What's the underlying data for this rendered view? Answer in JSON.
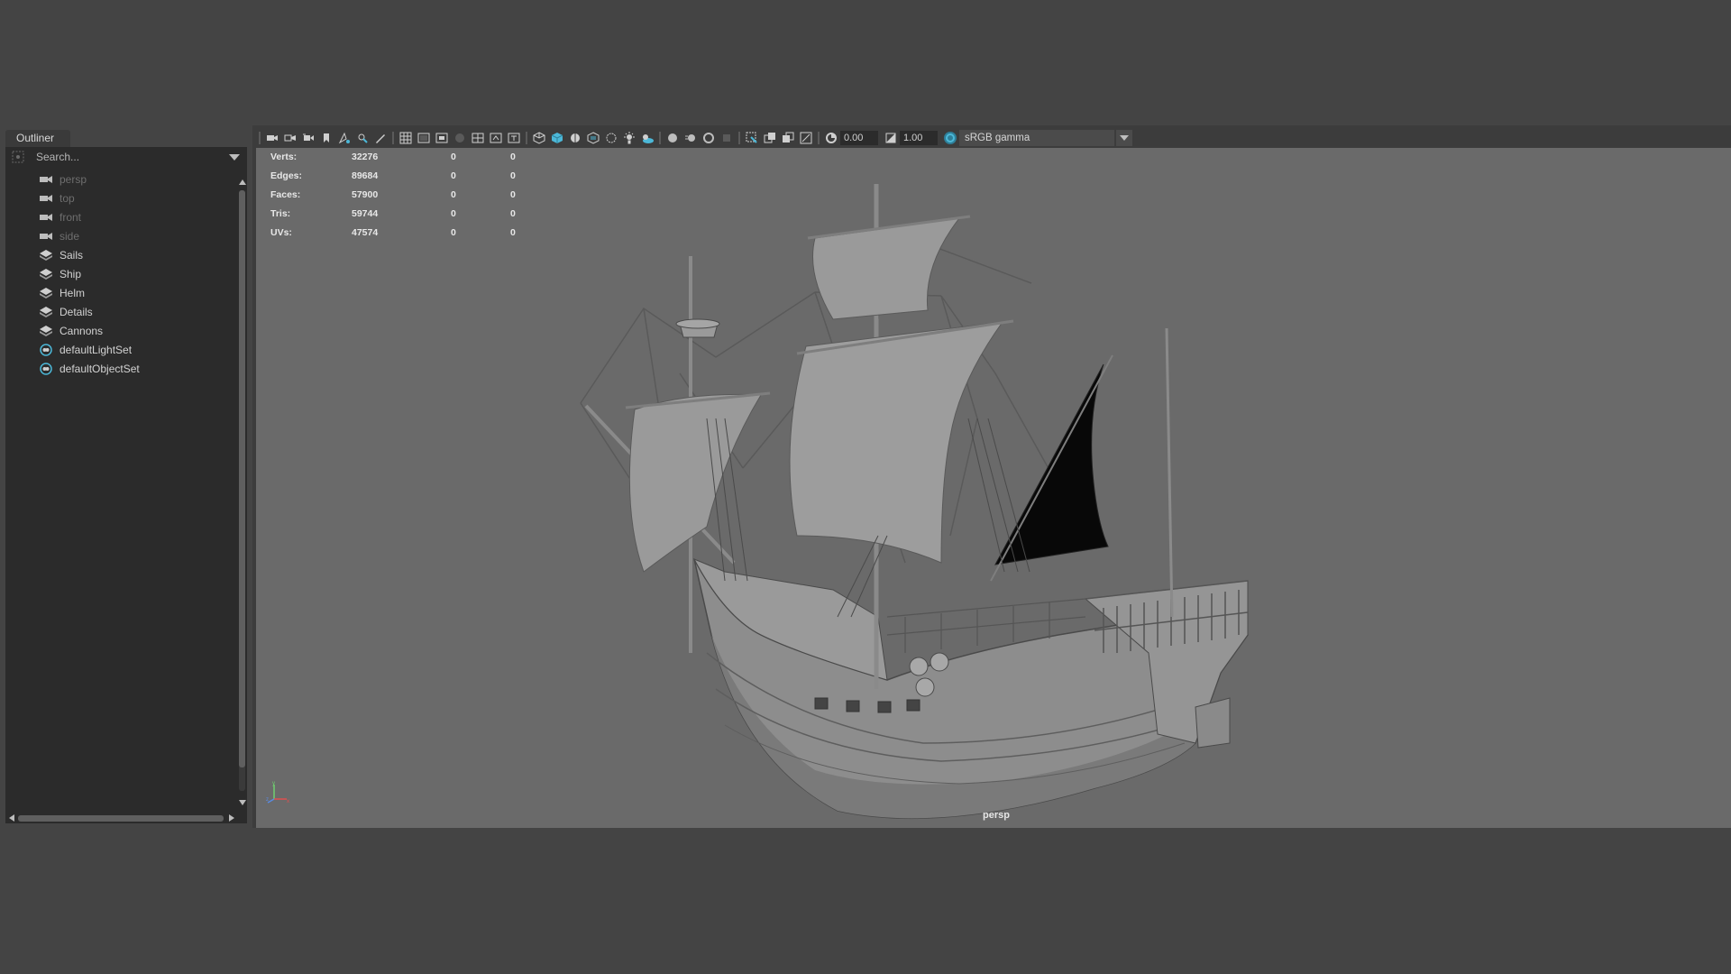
{
  "outliner": {
    "tab_label": "Outliner",
    "search_placeholder": "Search...",
    "items": [
      {
        "label": "persp",
        "type": "camera",
        "dim": true
      },
      {
        "label": "top",
        "type": "camera",
        "dim": true
      },
      {
        "label": "front",
        "type": "camera",
        "dim": true
      },
      {
        "label": "side",
        "type": "camera",
        "dim": true
      },
      {
        "label": "Sails",
        "type": "group",
        "dim": false
      },
      {
        "label": "Ship",
        "type": "group",
        "dim": false
      },
      {
        "label": "Helm",
        "type": "group",
        "dim": false
      },
      {
        "label": "Details",
        "type": "group",
        "dim": false
      },
      {
        "label": "Cannons",
        "type": "group",
        "dim": false
      },
      {
        "label": "defaultLightSet",
        "type": "set",
        "dim": false
      },
      {
        "label": "defaultObjectSet",
        "type": "set",
        "dim": false
      }
    ]
  },
  "toolbar": {
    "exposure_value": "0.00",
    "gamma_value": "1.00",
    "color_space": "sRGB gamma"
  },
  "hud": {
    "rows": [
      {
        "label": "Verts:",
        "v1": "32276",
        "v2": "0",
        "v3": "0"
      },
      {
        "label": "Edges:",
        "v1": "89684",
        "v2": "0",
        "v3": "0"
      },
      {
        "label": "Faces:",
        "v1": "57900",
        "v2": "0",
        "v3": "0"
      },
      {
        "label": "Tris:",
        "v1": "59744",
        "v2": "0",
        "v3": "0"
      },
      {
        "label": "UVs:",
        "v1": "47574",
        "v2": "0",
        "v3": "0"
      }
    ]
  },
  "viewport": {
    "camera_name": "persp",
    "model": "ship-model"
  },
  "colors": {
    "viewport_bg": "#6a6a6a",
    "panel_bg": "#2b2b2b",
    "accent_blue": "#4cb8d8"
  }
}
